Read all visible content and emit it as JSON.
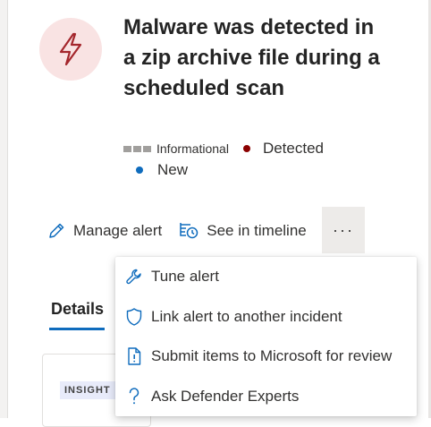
{
  "alert": {
    "title": "Malware was detected in a zip archive file during a scheduled scan",
    "severity_label": "Informational",
    "detection_status": "Detected",
    "state": "New"
  },
  "actions": {
    "manage_alert": "Manage alert",
    "see_in_timeline": "See in timeline",
    "more": "···"
  },
  "tabs": {
    "details": "Details"
  },
  "card": {
    "badge": "INSIGHT"
  },
  "menu": {
    "items": [
      {
        "label": "Tune alert",
        "icon": "wrench-icon"
      },
      {
        "label": "Link alert to another incident",
        "icon": "shield-icon"
      },
      {
        "label": "Submit items to Microsoft for review",
        "icon": "document-alert-icon"
      },
      {
        "label": "Ask Defender Experts",
        "icon": "question-icon"
      }
    ]
  },
  "colors": {
    "accent": "#0f6cbd",
    "detected_dot": "#8b0000",
    "alert_icon_bg": "#f9e3e3",
    "alert_icon_stroke": "#a4262c"
  }
}
